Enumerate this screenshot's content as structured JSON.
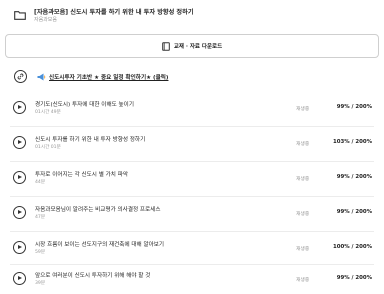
{
  "course": {
    "title": "[자음과모음] 신도시 투자를 하기 위한 내 투자 방향성 정하기",
    "subtitle": "자음과모음",
    "icon": "folder-icon"
  },
  "download": {
    "label": "교재 · 자료 다운로드",
    "icon": "book-icon"
  },
  "notice": {
    "text": "신도시투자 기초반 ★ 중요 일정 확인하기★ (클릭)",
    "icon": "link-icon",
    "emoji_icon": "megaphone-icon"
  },
  "lessons": [
    {
      "title": "경기도(신도시) 투자에 대한 이해도 높이기",
      "duration": "01시간 49분",
      "status": "재생중",
      "progress": "99% / 200%"
    },
    {
      "title": "신도시 투자를 하기 위한 내 투자 방향성 정하기",
      "duration": "01시간 01분",
      "status": "재생중",
      "progress": "103% / 200%"
    },
    {
      "title": "투자로 이어지는 각 신도시 별 가치 파악",
      "duration": "44분",
      "status": "재생중",
      "progress": "99% / 200%"
    },
    {
      "title": "자음과모음님이 알려주는 비교평가 의사결정 프로세스",
      "duration": "47분",
      "status": "재생중",
      "progress": "99% / 200%"
    },
    {
      "title": "시장 흐름이 보이는 선도지구의 재건축에 대해 알아보기",
      "duration": "59분",
      "status": "재생중",
      "progress": "100% / 200%"
    },
    {
      "title": "앞으로 여러분이 신도시 투자하기 위해 해야 할 것",
      "duration": "39분",
      "status": "재생중",
      "progress": "99% / 200%"
    }
  ]
}
